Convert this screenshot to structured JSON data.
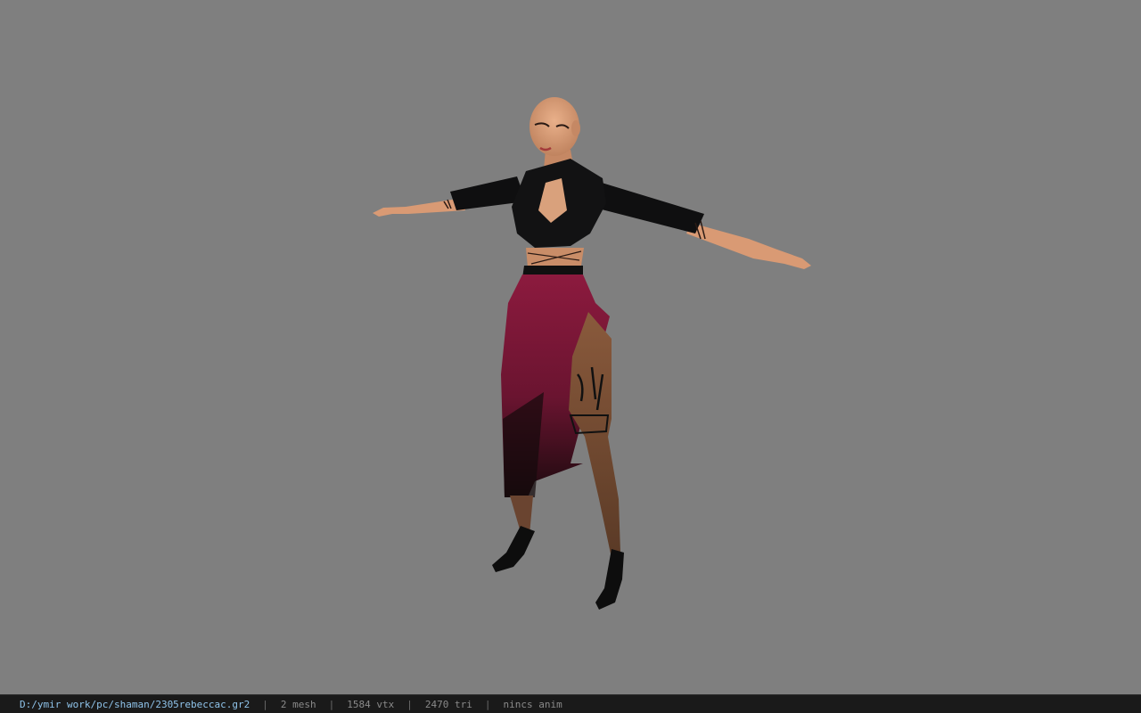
{
  "viewport": {
    "background": "#7f7f7f",
    "model_name": "3D character model (T-pose)"
  },
  "status_bar": {
    "file_path": "D:/ymir work/pc/shaman/2305rebeccac.gr2",
    "separator": "|",
    "mesh_count": "2 mesh",
    "vertex_count": "1584 vtx",
    "triangle_count": "2470 tri",
    "anim_status": "nincs anim"
  }
}
